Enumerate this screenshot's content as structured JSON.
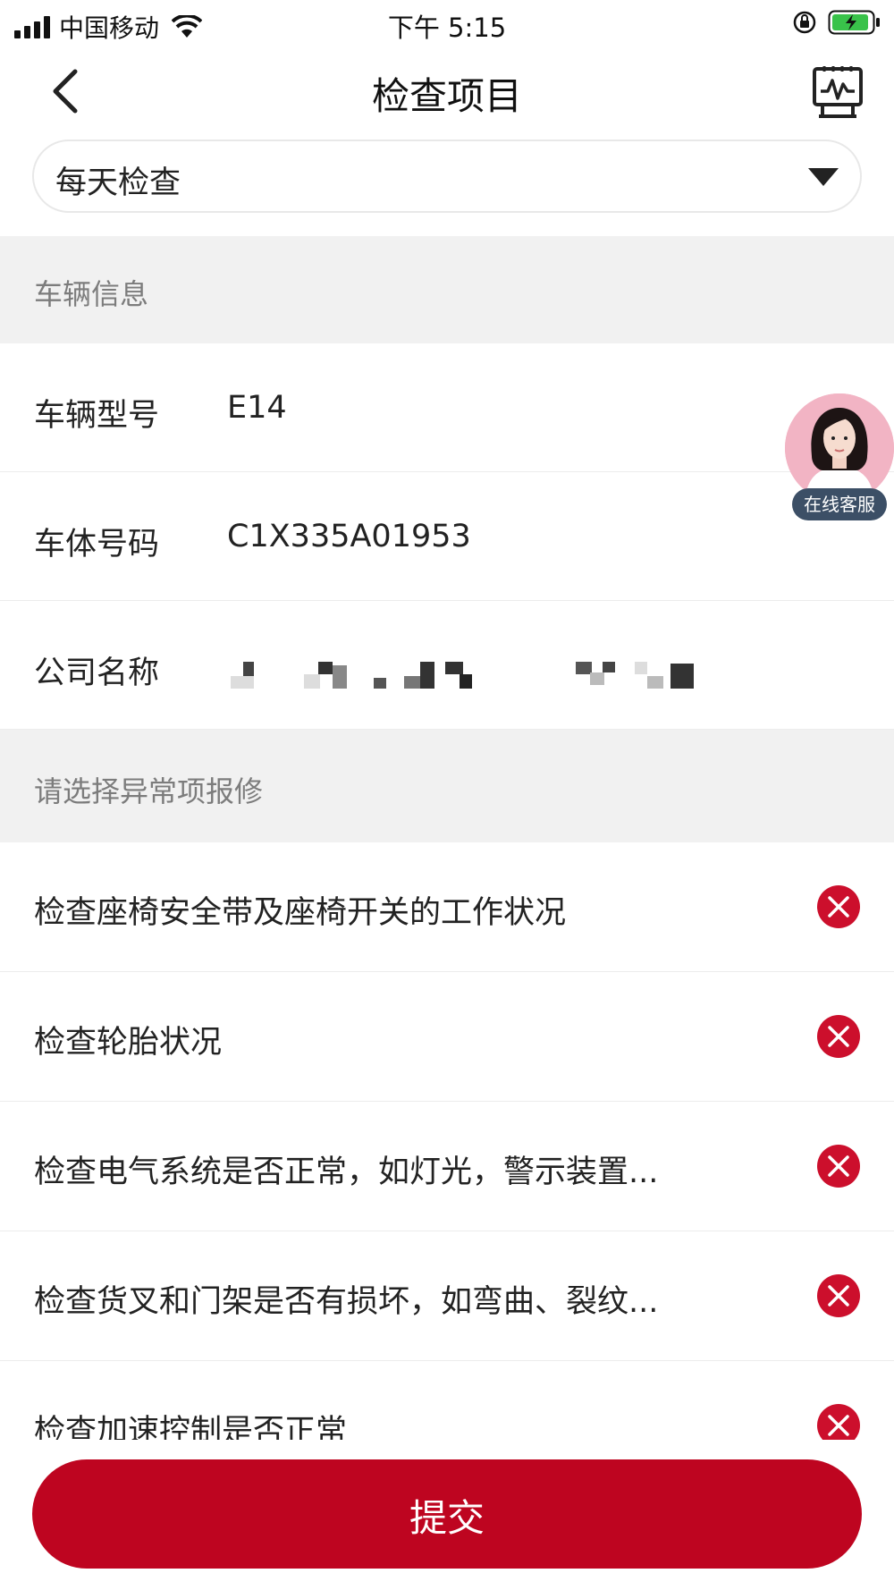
{
  "status_bar": {
    "carrier": "中国移动",
    "time": "下午 5:15"
  },
  "nav": {
    "title": "检查项目"
  },
  "frequency_select": {
    "value": "每天检查"
  },
  "vehicle_section": {
    "title": "车辆信息",
    "rows": [
      {
        "label": "车辆型号",
        "value": "E14"
      },
      {
        "label": "车体号码",
        "value": "C1X335A01953"
      },
      {
        "label": "公司名称",
        "value": ""
      }
    ]
  },
  "repair_section": {
    "title": "请选择异常项报修",
    "items": [
      {
        "label": "检查座椅安全带及座椅开关的工作状况"
      },
      {
        "label": "检查轮胎状况"
      },
      {
        "label": "检查电气系统是否正常，如灯光，警示装置..."
      },
      {
        "label": "检查货叉和门架是否有损坏，如弯曲、裂纹..."
      },
      {
        "label": "检查加速控制是否正常"
      }
    ]
  },
  "support": {
    "label": "在线客服"
  },
  "submit": {
    "label": "提交"
  },
  "colors": {
    "accent": "#be0520",
    "status_icon": "#cc0f2c",
    "section_bg": "#f1f1f1",
    "support_badge": "#3c4f66"
  },
  "icons": {
    "back": "chevron-left-icon",
    "chart": "chart-monitor-icon",
    "dropdown": "caret-down-icon",
    "abnormal": "close-circle-icon"
  }
}
